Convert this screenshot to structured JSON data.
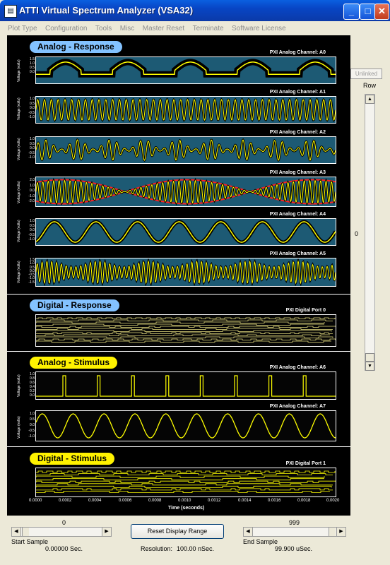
{
  "window": {
    "title": "ATTI Virtual Spectrum Analyzer (VSA32)"
  },
  "titlebar_buttons": {
    "minimize": "_",
    "maximize": "□",
    "close": "✕"
  },
  "menu": [
    "Plot Type",
    "Configuration",
    "Tools",
    "Misc",
    "Master Reset",
    "Terminate",
    "Software License"
  ],
  "sections": {
    "analog_response": "Analog - Response",
    "digital_response": "Digital - Response",
    "analog_stimulus": "Analog - Stimulus",
    "digital_stimulus": "Digital - Stimulus"
  },
  "y_axis_label": "Voltage (volts)",
  "channels": {
    "a0": "PXI Analog Channel: A0",
    "a1": "PXI Analog Channel: A1",
    "a2": "PXI Analog Channel: A2",
    "a3": "PXI Analog Channel: A3",
    "a4": "PXI Analog Channel: A4",
    "a5": "PXI Analog Channel: A5",
    "d0": "PXI Digital Port 0",
    "a6": "PXI Analog Channel: A6",
    "a7": "PXI Analog Channel: A7",
    "d1": "PXI Digital Port 1"
  },
  "x_axis": {
    "title": "Time (seconds)",
    "ticks": [
      "0.0000",
      "0.0002",
      "0.0004",
      "0.0006",
      "0.0008",
      "0.0010",
      "0.0012",
      "0.0014",
      "0.0016",
      "0.0018",
      "0.0020"
    ]
  },
  "ticks": {
    "a0": [
      "1.5",
      "1.0",
      "0.5",
      "0.0"
    ],
    "a1": [
      "1.0",
      "0.5",
      "0.0",
      "-0.5",
      "-1.0"
    ],
    "a2": [
      "1.0",
      "0.5",
      "0.0",
      "-0.5",
      "-1.0"
    ],
    "a3": [
      "2.0",
      "1.0",
      "0.0",
      "-1.0",
      "-2.0"
    ],
    "a4": [
      "1.0",
      "0.5",
      "0.0",
      "-0.5",
      "-1.0"
    ],
    "a5": [
      "1.5",
      "1.0",
      "0.5",
      "0.0",
      "-0.5",
      "-1.0",
      "-1.5"
    ],
    "a6": [
      "1.0",
      "0.8",
      "0.6",
      "0.4",
      "0.2",
      "0.0"
    ],
    "a7": [
      "1.0",
      "0.5",
      "0.0",
      "-0.5",
      "-1.0"
    ]
  },
  "right_panel": {
    "unlinked": "Unlinked",
    "row_label": "Row",
    "row_value": "0"
  },
  "bottom": {
    "start_value": "0",
    "end_value": "999",
    "reset_button": "Reset Display Range",
    "start_label": "Start Sample",
    "end_label": "End Sample",
    "start_time": "0.00000 Sec.",
    "resolution_label": "Resolution:",
    "resolution_value": "100.00 nSec.",
    "end_time": "99.900 uSec."
  },
  "colors": {
    "teal_plot": "#1d5a74",
    "trace_yellow": "#ffff00",
    "section_blue": "#83c2ff",
    "section_yellow": "#fff200",
    "accent_red": "#ff2020"
  }
}
